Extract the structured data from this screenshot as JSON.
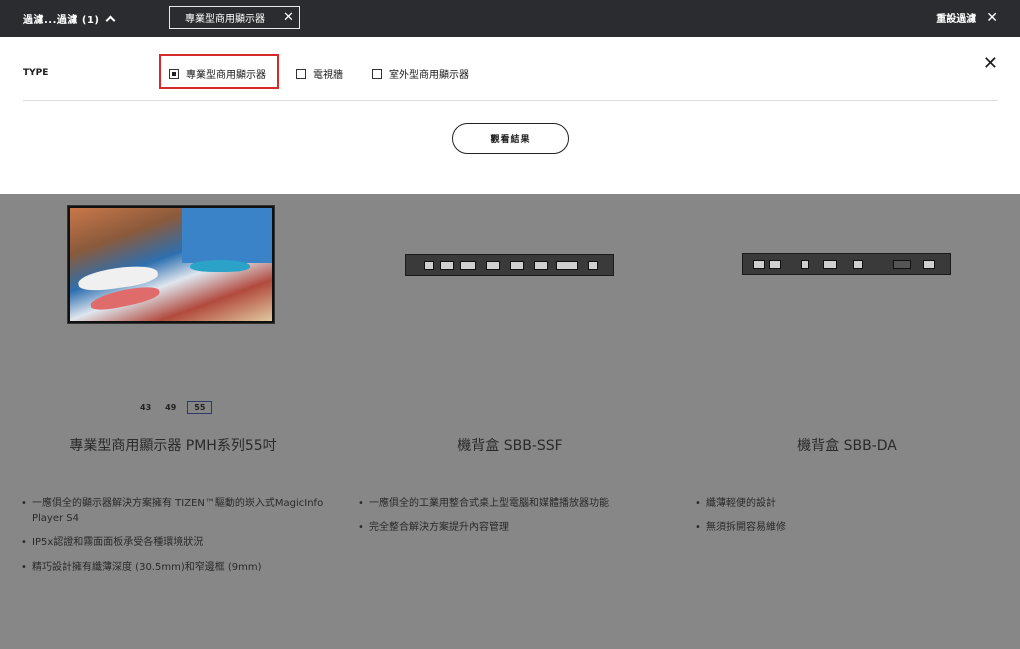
{
  "topbar": {
    "filter_toggle_label": "過濾...過濾 (1)",
    "active_chip_label": "專業型商用顯示器",
    "chip_close": "✕",
    "reset_label": "重設過濾",
    "reset_close": "✕"
  },
  "filter_panel": {
    "type_label": "TYPE",
    "options": [
      {
        "label": "專業型商用顯示器",
        "checked": true
      },
      {
        "label": "電視牆",
        "checked": false
      },
      {
        "label": "室外型商用顯示器",
        "checked": false
      }
    ],
    "close_icon": "✕",
    "view_results_label": "觀看結果"
  },
  "products": [
    {
      "title": "專業型商用顯示器 PMH系列55吋",
      "sizes": [
        "43",
        "49",
        "55"
      ],
      "selected_size": "55",
      "features": [
        "一應俱全的顯示器解決方案擁有 TIZEN™驅動的崁入式MagicInfo Player S4",
        "IP5x認證和霧面面板承受各種環境狀況",
        "精巧設計擁有纖薄深度 (30.5mm)和窄邊框 (9mm)"
      ]
    },
    {
      "title": "機背盒 SBB-SSF",
      "features": [
        "一應俱全的工業用整合式桌上型電腦和媒體播放器功能",
        "完全整合解決方案提升內容管理"
      ]
    },
    {
      "title": "機背盒 SBB-DA",
      "features": [
        "纖薄輕便的設計",
        "無須拆開容易維修"
      ]
    }
  ]
}
